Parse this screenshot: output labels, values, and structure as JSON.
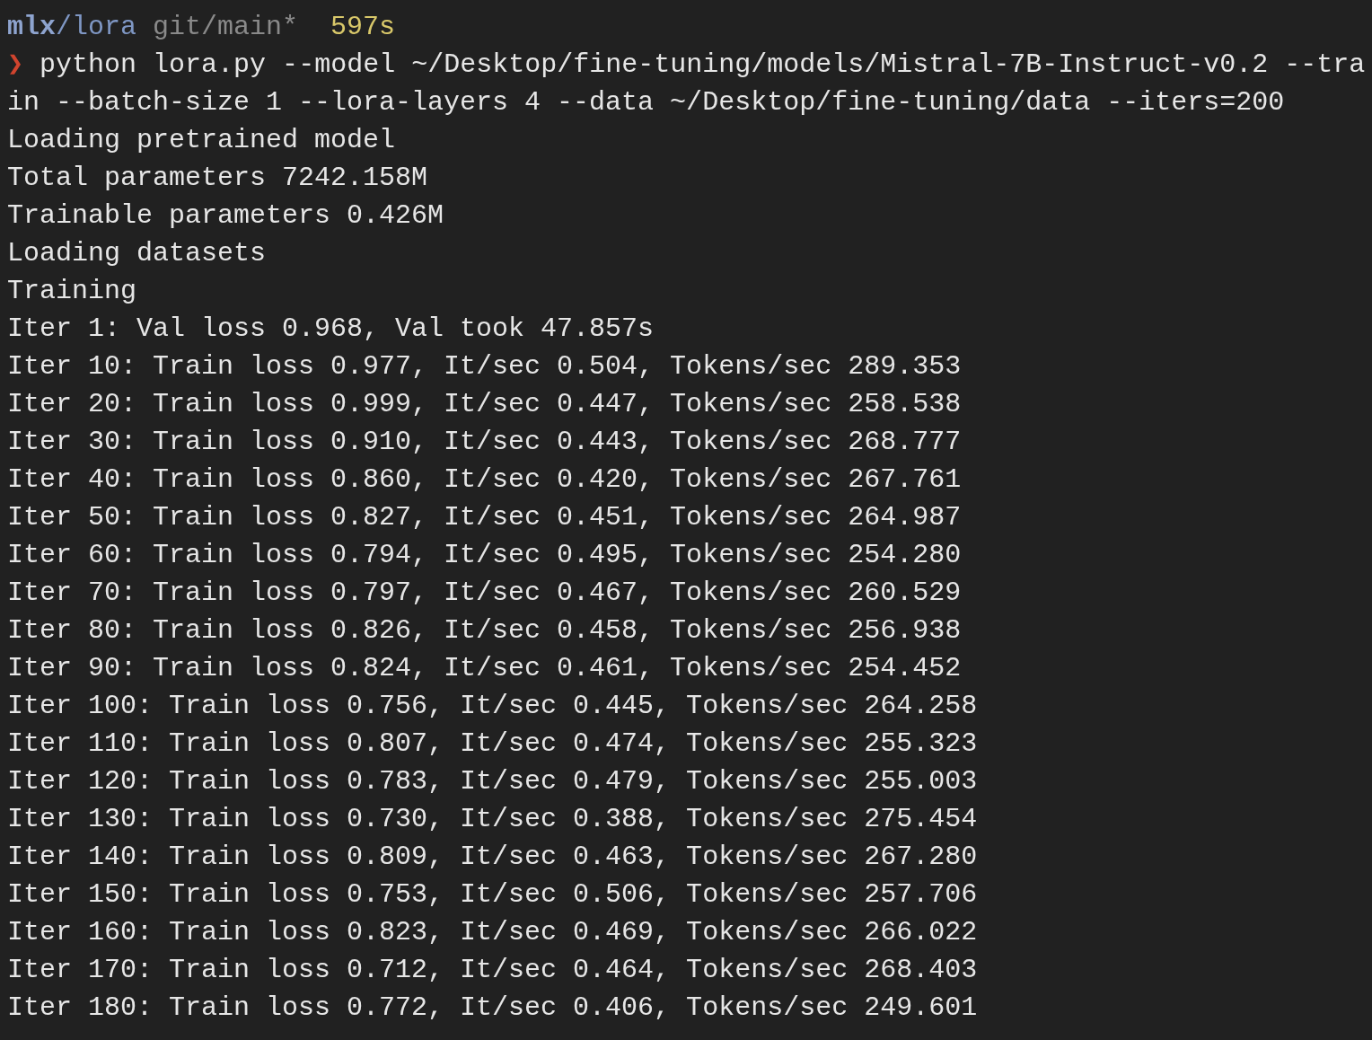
{
  "prompt": {
    "directory_root": "mlx",
    "directory_rest": "/lora",
    "git_branch": "git/main*",
    "duration": "597s"
  },
  "command": {
    "symbol": "❯",
    "lines": [
      "python lora.py --model ~/Desktop/fine-tuning/models/Mistral-7B-Instruct-v0.2 --tra",
      "in --batch-size 1 --lora-layers 4 --data ~/Desktop/fine-tuning/data --iters=200"
    ]
  },
  "output_lines": [
    "Loading pretrained model",
    "Total parameters 7242.158M",
    "Trainable parameters 0.426M",
    "Loading datasets",
    "Training",
    "Iter 1: Val loss 0.968, Val took 47.857s",
    "Iter 10: Train loss 0.977, It/sec 0.504, Tokens/sec 289.353",
    "Iter 20: Train loss 0.999, It/sec 0.447, Tokens/sec 258.538",
    "Iter 30: Train loss 0.910, It/sec 0.443, Tokens/sec 268.777",
    "Iter 40: Train loss 0.860, It/sec 0.420, Tokens/sec 267.761",
    "Iter 50: Train loss 0.827, It/sec 0.451, Tokens/sec 264.987",
    "Iter 60: Train loss 0.794, It/sec 0.495, Tokens/sec 254.280",
    "Iter 70: Train loss 0.797, It/sec 0.467, Tokens/sec 260.529",
    "Iter 80: Train loss 0.826, It/sec 0.458, Tokens/sec 256.938",
    "Iter 90: Train loss 0.824, It/sec 0.461, Tokens/sec 254.452",
    "Iter 100: Train loss 0.756, It/sec 0.445, Tokens/sec 264.258",
    "Iter 110: Train loss 0.807, It/sec 0.474, Tokens/sec 255.323",
    "Iter 120: Train loss 0.783, It/sec 0.479, Tokens/sec 255.003",
    "Iter 130: Train loss 0.730, It/sec 0.388, Tokens/sec 275.454",
    "Iter 140: Train loss 0.809, It/sec 0.463, Tokens/sec 267.280",
    "Iter 150: Train loss 0.753, It/sec 0.506, Tokens/sec 257.706",
    "Iter 160: Train loss 0.823, It/sec 0.469, Tokens/sec 266.022",
    "Iter 170: Train loss 0.712, It/sec 0.464, Tokens/sec 268.403",
    "Iter 180: Train loss 0.772, It/sec 0.406, Tokens/sec 249.601"
  ]
}
